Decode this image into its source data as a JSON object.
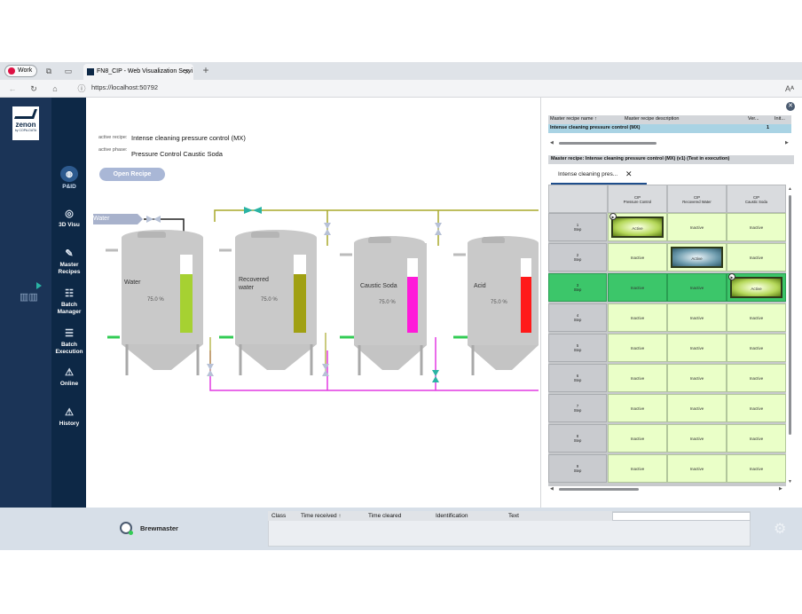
{
  "browser": {
    "profile_label": "Work",
    "tab_title": "FN8_CIP - Web Visualization Servi",
    "url": "https://localhost:50792"
  },
  "sidebar": {
    "logo_text": "zenon",
    "logo_sub": "by COPA-DATA",
    "items": [
      {
        "label": "P&ID"
      },
      {
        "label": "3D Visu"
      },
      {
        "label": "Master Recipes"
      },
      {
        "label": "Batch Manager"
      },
      {
        "label": "Batch Execution"
      },
      {
        "label": "Online"
      },
      {
        "label": "History"
      }
    ]
  },
  "header": {
    "active_recipe_label": "active recipe:",
    "active_recipe_value": "Intense cleaning pressure control (MX)",
    "active_phase_label": "active phase:",
    "active_phase_value": "Pressure Control Caustic Soda",
    "open_recipe_button": "Open Recipe"
  },
  "pid": {
    "source_label": "Water",
    "tanks": [
      {
        "name_line1": "Water",
        "name_line2": "",
        "level_text": "75.0 %",
        "level": 0.75,
        "fill_color": "#a6d132"
      },
      {
        "name_line1": "Recovered",
        "name_line2": "water",
        "level_text": "75.0 %",
        "level": 0.75,
        "fill_color": "#a0a012"
      },
      {
        "name_line1": "Caustic Soda",
        "name_line2": "",
        "level_text": "75.0 %",
        "level": 0.75,
        "fill_color": "#ff1ad9"
      },
      {
        "name_line1": "Acid",
        "name_line2": "",
        "level_text": "75.0 %",
        "level": 0.75,
        "fill_color": "#ff1a1a"
      }
    ]
  },
  "right_panel": {
    "table_headers": [
      "Master recipe name",
      "Master recipe description",
      "Ver...",
      "Init..."
    ],
    "table_row": {
      "name": "Intense cleaning pressure control (MX)",
      "description": "",
      "version": "1",
      "init": ""
    },
    "detail_title": "Master recipe: Intense cleaning pressure control (MX) (v1) (Test in execution)",
    "tab_label": "Intense cleaning pres...",
    "columns": [
      {
        "line1": "CIP",
        "line2": "Pressure Control"
      },
      {
        "line1": "CIP",
        "line2": "Recovered Water"
      },
      {
        "line1": "CIP",
        "line2": "Caustic Soda"
      }
    ],
    "rows": [
      {
        "num": "1",
        "label": "Step",
        "cells": [
          "Active",
          "Inactive",
          "Inactive"
        ]
      },
      {
        "num": "2",
        "label": "Step",
        "cells": [
          "Inactive",
          "Active",
          "Inactive"
        ]
      },
      {
        "num": "3",
        "label": "Step",
        "cells": [
          "Inactive",
          "Inactive",
          "Active"
        ]
      },
      {
        "num": "4",
        "label": "Step",
        "cells": [
          "Inactive",
          "Inactive",
          "Inactive"
        ]
      },
      {
        "num": "5",
        "label": "Step",
        "cells": [
          "Inactive",
          "Inactive",
          "Inactive"
        ]
      },
      {
        "num": "6",
        "label": "Step",
        "cells": [
          "Inactive",
          "Inactive",
          "Inactive"
        ]
      },
      {
        "num": "7",
        "label": "Step",
        "cells": [
          "Inactive",
          "Inactive",
          "Inactive"
        ]
      },
      {
        "num": "8",
        "label": "Step",
        "cells": [
          "Inactive",
          "Inactive",
          "Inactive"
        ]
      },
      {
        "num": "9",
        "label": "Step",
        "cells": [
          "Inactive",
          "Inactive",
          "Inactive"
        ]
      }
    ]
  },
  "footer": {
    "user": "Brewmaster",
    "alarm_headers": [
      "Class",
      "Time received",
      "Time cleared",
      "Identification",
      "Text"
    ]
  },
  "colors": {
    "sidebar_bg": "#0d2846",
    "active_green": "#3cc66a",
    "inactive_cell": "#eaffc8",
    "pipe_yellow": "#a8a82a",
    "pipe_magenta": "#e23ae2",
    "valve_teal": "#2ab3a4"
  }
}
